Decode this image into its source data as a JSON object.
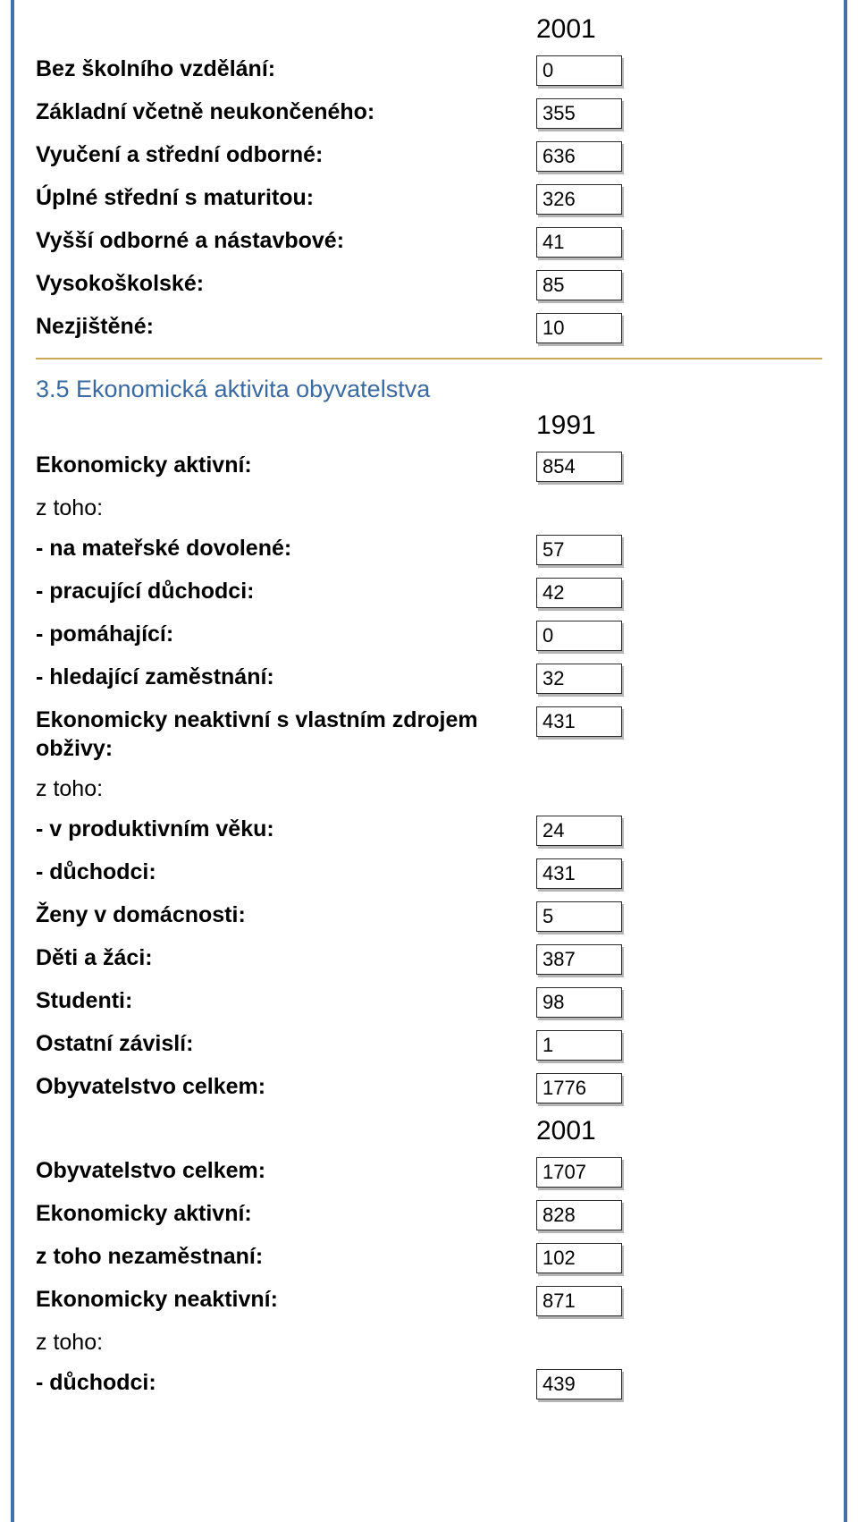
{
  "section1": {
    "year": "2001",
    "rows": [
      {
        "label": "Bez školního vzdělání:",
        "value": "0"
      },
      {
        "label": "Základní včetně neukončeného:",
        "value": "355"
      },
      {
        "label": "Vyučení a střední odborné:",
        "value": "636"
      },
      {
        "label": "Úplné střední s maturitou:",
        "value": "326"
      },
      {
        "label": "Vyšší odborné a nástavbové:",
        "value": "41"
      },
      {
        "label": "Vysokoškolské:",
        "value": "85"
      },
      {
        "label": "Nezjištěné:",
        "value": "10"
      }
    ]
  },
  "section2": {
    "title": "3.5 Ekonomická aktivita obyvatelstva",
    "year1991": "1991",
    "rows1991": {
      "ekon_aktivni": {
        "label": "Ekonomicky aktivní:",
        "value": "854"
      },
      "ztoho1": {
        "label": "z toho:"
      },
      "na_materske": {
        "label": "- na mateřské dovolené:",
        "value": "57"
      },
      "pracujici_duch": {
        "label": "- pracující důchodci:",
        "value": "42"
      },
      "pomahajici": {
        "label": "- pomáhající:",
        "value": "0"
      },
      "hledajici": {
        "label": "- hledající zaměstnání:",
        "value": "32"
      },
      "neaktivni_vlastni": {
        "label": "Ekonomicky neaktivní s vlastním zdrojem obživy:",
        "value": "431"
      },
      "ztoho2": {
        "label": "z toho:"
      },
      "produktivni_vek": {
        "label": "- v produktivním věku:",
        "value": "24"
      },
      "duchodci1": {
        "label": "- důchodci:",
        "value": "431"
      },
      "zeny": {
        "label": "Ženy v domácnosti:",
        "value": "5"
      },
      "deti": {
        "label": "Děti a žáci:",
        "value": "387"
      },
      "studenti": {
        "label": "Studenti:",
        "value": "98"
      },
      "ostatni": {
        "label": "Ostatní závislí:",
        "value": "1"
      },
      "celkem1": {
        "label": "Obyvatelstvo celkem:",
        "value": "1776"
      }
    },
    "year2001": "2001",
    "rows2001": {
      "celkem2": {
        "label": "Obyvatelstvo celkem:",
        "value": "1707"
      },
      "ekon_aktivni2": {
        "label": "Ekonomicky aktivní:",
        "value": "828"
      },
      "nezamestnani": {
        "label": "z toho nezaměstnaní:",
        "value": "102"
      },
      "neaktivni": {
        "label": "Ekonomicky neaktivní:",
        "value": "871"
      },
      "ztoho3": {
        "label": "z toho:"
      },
      "duchodci2": {
        "label": "- důchodci:",
        "value": "439"
      }
    }
  }
}
